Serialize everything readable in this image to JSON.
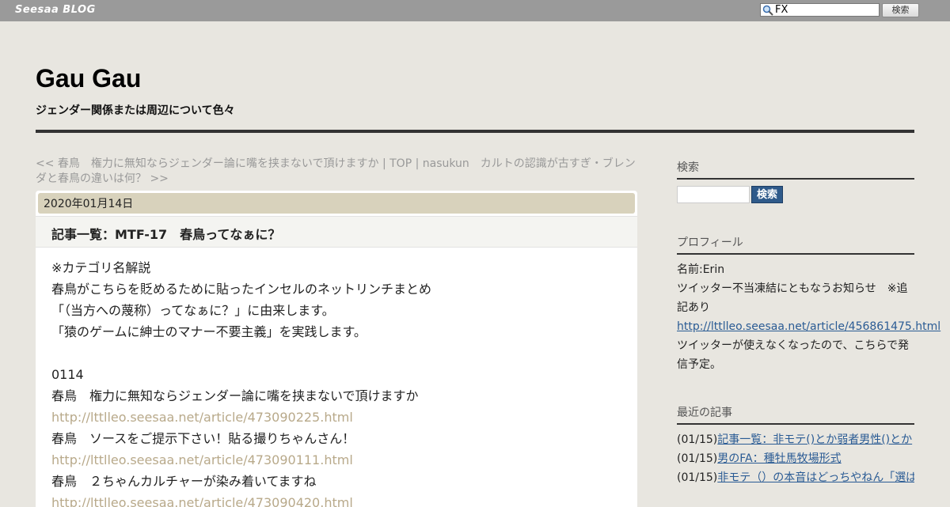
{
  "topbar": {
    "brand": "Seesaa BLOG",
    "search_value": "FX",
    "search_button": "検索"
  },
  "header": {
    "title": "Gau Gau",
    "description": "ジェンダー関係または周辺について色々"
  },
  "nav": {
    "prev": "<< 春鳥　権力に無知ならジェンダー論に嘴を挟まないで頂けますか",
    "sep1": " | ",
    "top": "TOP",
    "sep2": " | ",
    "next": "nasukun　カルトの認識が古すぎ・ブレンダと春鳥の違いは何？ >>"
  },
  "article": {
    "date": "2020年01月14日",
    "title": "記事一覧：MTF-17　春鳥ってなぁに？",
    "lines": [
      {
        "text": "※カテゴリ名解説",
        "link": false
      },
      {
        "text": "春鳥がこちらを貶めるために貼ったインセルのネットリンチまとめ",
        "link": false
      },
      {
        "text": "「（当方への蔑称）ってなぁに？」に由来します。",
        "link": false
      },
      {
        "text": "「猿のゲームに紳士のマナー不要主義」を実践します。",
        "link": false
      },
      {
        "text": "",
        "link": false
      },
      {
        "text": "0114",
        "link": false
      },
      {
        "text": "春鳥　権力に無知ならジェンダー論に嘴を挟まないで頂けますか",
        "link": false
      },
      {
        "text": "http://lttlleo.seesaa.net/article/473090225.html",
        "link": true
      },
      {
        "text": "春鳥　ソースをご提示下さい！貼る撮りちゃんさん！",
        "link": false
      },
      {
        "text": "http://lttlleo.seesaa.net/article/473090111.html",
        "link": true
      },
      {
        "text": "春鳥　２ちゃんカルチャーが染み着いてますね",
        "link": false
      },
      {
        "text": "http://lttlleo.seesaa.net/article/473090420.html",
        "link": true
      }
    ]
  },
  "sidebar": {
    "search_heading": "検索",
    "search_button": "検索",
    "profile_heading": "プロフィール",
    "profile_name": "名前:Erin",
    "profile_text1a": "ツイッター不当凍結にともなうお知らせ　※追",
    "profile_text1b": "記あり",
    "profile_link": "http://lttlleo.seesaa.net/article/456861475.html",
    "profile_text2a": "ツイッターが使えなくなったので、こちらで発",
    "profile_text2b": "信予定。",
    "recent_heading": "最近の記事",
    "recent": [
      {
        "date": "(01/15)",
        "title": "記事一覧：非モテ()とか弱者男性()とか"
      },
      {
        "date": "(01/15)",
        "title": "男のFA：種牡馬牧場形式"
      },
      {
        "date": "(01/15)",
        "title": "非モテ（）の本音はどっちやねん「選ばれたい/与えられたい」"
      }
    ]
  }
}
